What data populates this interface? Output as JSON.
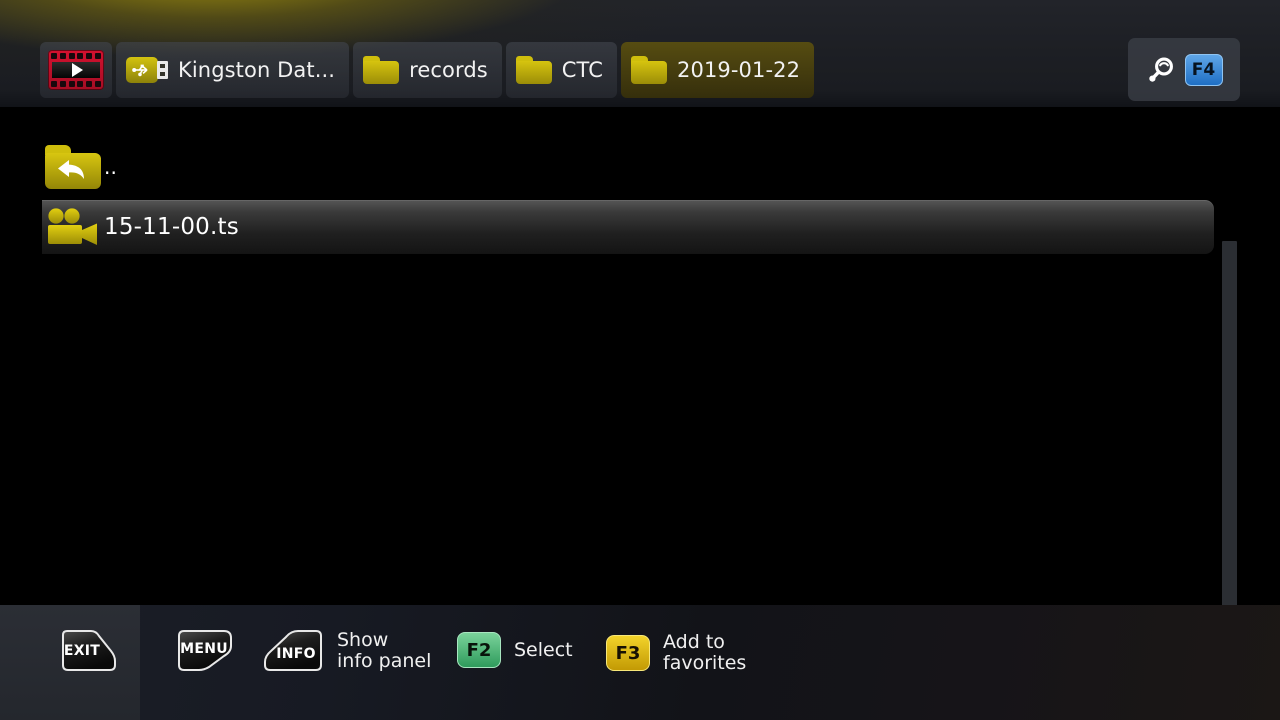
{
  "header": {
    "breadcrumbs": [
      {
        "label": "",
        "icon": "film-strip-icon",
        "selected": false
      },
      {
        "label": "Kingston Dat...",
        "icon": "usb-drive-icon",
        "selected": false
      },
      {
        "label": "records",
        "icon": "folder-icon",
        "selected": false
      },
      {
        "label": "CTC",
        "icon": "folder-icon",
        "selected": false
      },
      {
        "label": "2019-01-22",
        "icon": "folder-icon",
        "selected": true
      }
    ],
    "search": {
      "icon": "magnifier-icon",
      "key_label": "F4"
    }
  },
  "file_list": {
    "items": [
      {
        "label": "..",
        "icon": "folder-up-icon",
        "selected": false
      },
      {
        "label": "15-11-00.ts",
        "icon": "movie-camera-icon",
        "selected": true
      }
    ]
  },
  "bottom_bar": {
    "hints": [
      {
        "key": "EXIT",
        "label": ""
      },
      {
        "key": "MENU",
        "label": ""
      },
      {
        "key": "INFO",
        "label": "Show\ninfo panel"
      },
      {
        "key": "F2",
        "label": "Select"
      },
      {
        "key": "F3",
        "label": "Add to\nfavorites"
      }
    ]
  },
  "colors": {
    "accent_yellow": "#d6c40f",
    "accent_red": "#c8102e",
    "accent_blue": "#1f6fc4",
    "key_green": "#2f9b5c",
    "key_yellow": "#c39a04",
    "background": "#000000"
  }
}
